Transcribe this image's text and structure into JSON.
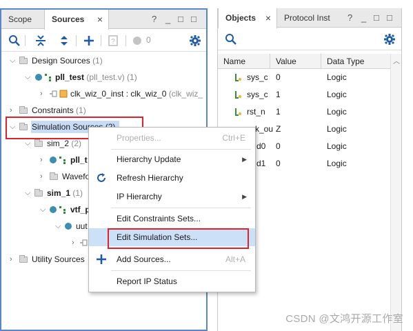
{
  "left": {
    "tabs": [
      {
        "label": "Scope",
        "active": false
      },
      {
        "label": "Sources",
        "active": true
      }
    ],
    "window_controls": [
      "?",
      "_",
      "□",
      "□"
    ],
    "toolbar": {
      "badge_count": "0"
    },
    "tree": {
      "design_sources": {
        "name": "Design Sources",
        "count": "(1)"
      },
      "pll_test": {
        "name": "pll_test",
        "file": "(pll_test.v) (1)"
      },
      "clk_wiz": {
        "name": "clk_wiz_0_inst : clk_wiz_0",
        "file": "(clk_wiz_"
      },
      "constraints": {
        "name": "Constraints",
        "count": "(1)"
      },
      "simulation_sources": {
        "name": "Simulation Sources (2)"
      },
      "sim_2": {
        "name": "sim_2",
        "count": "(2)"
      },
      "pll_t": {
        "name": "pll_t"
      },
      "wavefo": {
        "name": "Wavefo"
      },
      "sim_1": {
        "name": "sim_1",
        "count": "(1)"
      },
      "vtf": {
        "name": "vtf_p"
      },
      "uut": {
        "name": "uut"
      },
      "utility_sources": {
        "name": "Utility Sources"
      }
    }
  },
  "right": {
    "tabs": [
      {
        "label": "Objects",
        "active": true
      },
      {
        "label": "Protocol Inst",
        "active": false
      }
    ],
    "columns": [
      "Name",
      "Value",
      "Data Type"
    ],
    "rows": [
      {
        "name": "sys_c",
        "value": "0",
        "type": "Logic"
      },
      {
        "name": "sys_c",
        "value": "1",
        "type": "Logic"
      },
      {
        "name": "rst_n",
        "value": "1",
        "type": "Logic"
      },
      {
        "name": "k_ou",
        "value": "Z",
        "type": "Logic"
      },
      {
        "name": "d0",
        "value": "0",
        "type": "Logic"
      },
      {
        "name": "d1",
        "value": "0",
        "type": "Logic"
      }
    ]
  },
  "context_menu": {
    "items": [
      {
        "label": "Properties...",
        "shortcut": "Ctrl+E",
        "disabled": true
      },
      {
        "label": "Hierarchy Update",
        "submenu": true
      },
      {
        "label": "Refresh Hierarchy"
      },
      {
        "label": "IP Hierarchy",
        "submenu": true
      },
      {
        "label": "Edit Constraints Sets..."
      },
      {
        "label": "Edit Simulation Sets...",
        "highlighted": true
      },
      {
        "label": "Add Sources...",
        "shortcut": "Alt+A"
      },
      {
        "label": "Report IP Status"
      }
    ]
  },
  "watermark": "CSDN @文鸿开源工作室",
  "colors": {
    "accent": "#5b86c5",
    "highlight": "#e0202a",
    "selection": "#c9dcf5",
    "node": "#3a8fb0"
  }
}
